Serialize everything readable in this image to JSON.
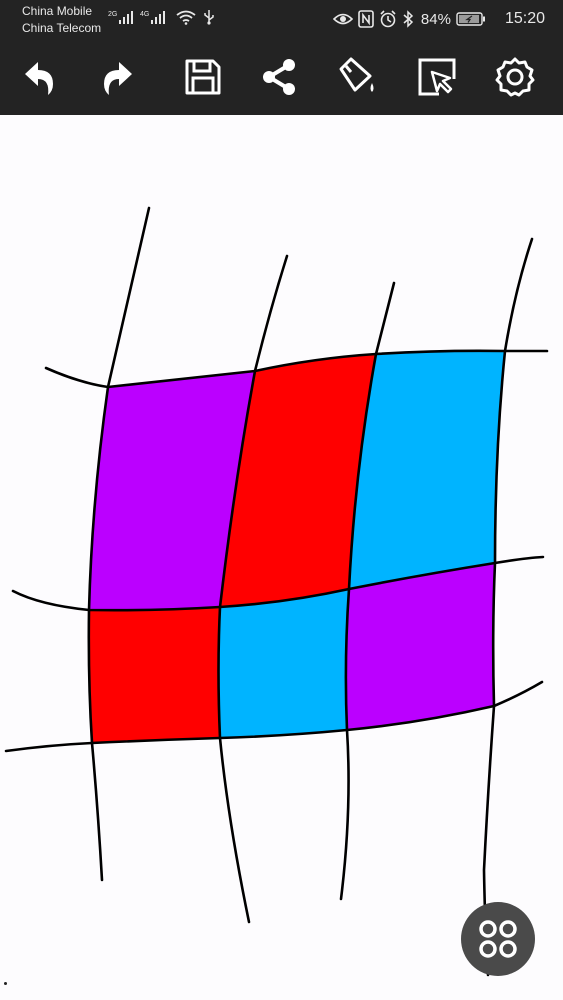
{
  "status_bar": {
    "carrier_1": "China Mobile",
    "carrier_2": "China Telecom",
    "network_1": "2G",
    "network_2": "4G",
    "battery": "84%",
    "time": "15:20",
    "icons": [
      "signal-icon",
      "wifi-icon",
      "usb-icon",
      "eye-icon",
      "nfc-icon",
      "alarm-icon",
      "bluetooth-icon",
      "battery-icon"
    ]
  },
  "toolbar": {
    "tools": [
      "undo-icon",
      "redo-icon",
      "save-icon",
      "share-icon",
      "fill-bucket-icon",
      "select-icon",
      "settings-icon"
    ]
  },
  "canvas": {
    "background": "#fdfcfe",
    "colors": {
      "purple": "#bb00ff",
      "red": "#ff0000",
      "blue": "#00b4ff",
      "stroke": "#000000"
    },
    "grid_fills": [
      [
        "purple",
        "red",
        "blue"
      ],
      [
        "red",
        "blue",
        "purple"
      ]
    ]
  },
  "fab": {
    "icon": "four-dots-menu-icon"
  }
}
